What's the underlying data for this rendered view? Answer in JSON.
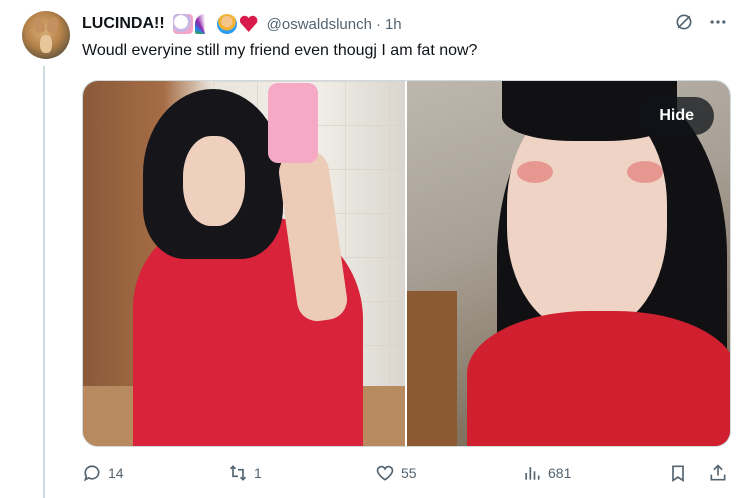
{
  "tweet": {
    "display_name": "LUCINDA!!",
    "emojis": [
      "unicorn",
      "rainbow",
      "person-yellow-hair",
      "sparkling-heart"
    ],
    "handle": "@oswaldslunch",
    "separator": "·",
    "time": "1h",
    "text": "Woudl everyine still my friend even thougj I am fat now?",
    "media": {
      "hide_label": "Hide",
      "photo_count": 2
    },
    "actions": {
      "replies": "14",
      "reposts": "1",
      "likes": "55",
      "views": "681"
    }
  },
  "icons": {
    "header": [
      "circle-slash-icon",
      "more-icon"
    ],
    "actions": [
      "reply-icon",
      "retweet-icon",
      "like-icon",
      "views-icon",
      "bookmark-icon",
      "share-icon"
    ]
  },
  "colors": {
    "text_primary": "#0f1419",
    "text_secondary": "#536471",
    "border": "#cfd9de"
  }
}
